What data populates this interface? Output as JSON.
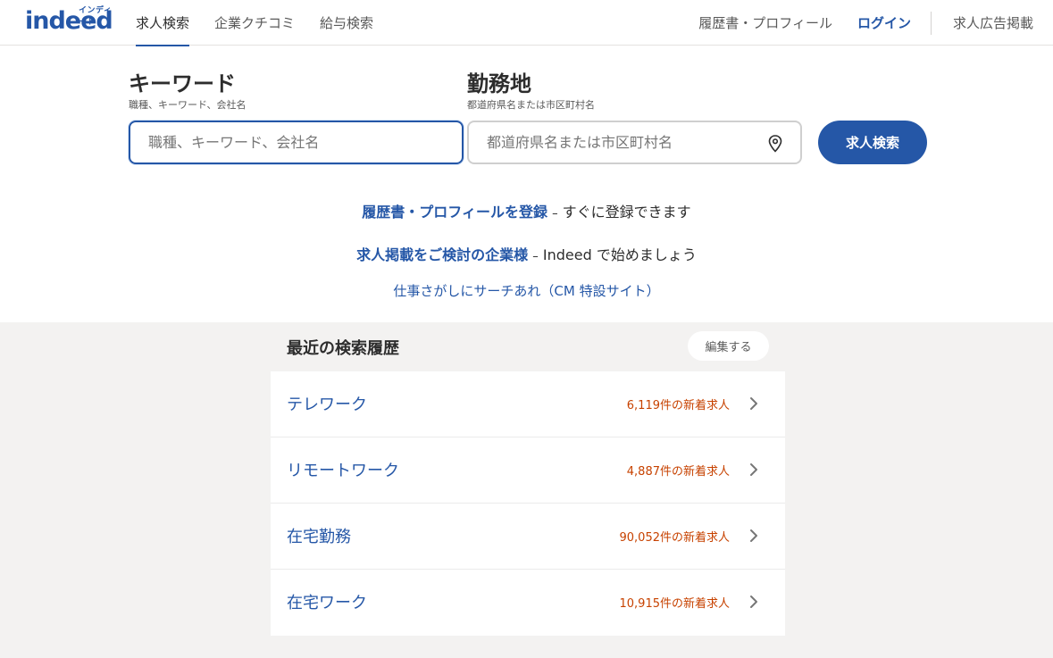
{
  "header": {
    "logo_kana": "インディード",
    "logo_text": "indeed",
    "nav_left": [
      "求人検索",
      "企業クチコミ",
      "給与検索"
    ],
    "resume_link": "履歴書・プロフィール",
    "login": "ログイン",
    "post_job": "求人広告掲載"
  },
  "search": {
    "keyword_label": "キーワード",
    "keyword_sub": "職種、キーワード、会社名",
    "keyword_placeholder": "職種、キーワード、会社名",
    "location_label": "勤務地",
    "location_sub": "都道府県名または市区町村名",
    "location_placeholder": "都道府県名または市区町村名",
    "button": "求人検索"
  },
  "promo": {
    "line1_link": "履歴書・プロフィールを登録",
    "line1_dash": "–",
    "line1_text": "すぐに登録できます",
    "line2_link": "求人掲載をご検討の企業様",
    "line2_dash": "–",
    "line2_text": "Indeed で始めましょう",
    "line3_link": "仕事さがしにサーチあれ（CM 特設サイト）"
  },
  "recent": {
    "title": "最近の検索履歴",
    "edit": "編集する",
    "items": [
      {
        "title": "テレワーク",
        "count": "6,119件の新着求人"
      },
      {
        "title": "リモートワーク",
        "count": "4,887件の新着求人"
      },
      {
        "title": "在宅勤務",
        "count": "90,052件の新着求人"
      },
      {
        "title": "在宅ワーク",
        "count": "10,915件の新着求人"
      }
    ]
  },
  "colors": {
    "brand": "#2557a7",
    "count": "#c74200",
    "bg_recent": "#f3f2f1"
  }
}
